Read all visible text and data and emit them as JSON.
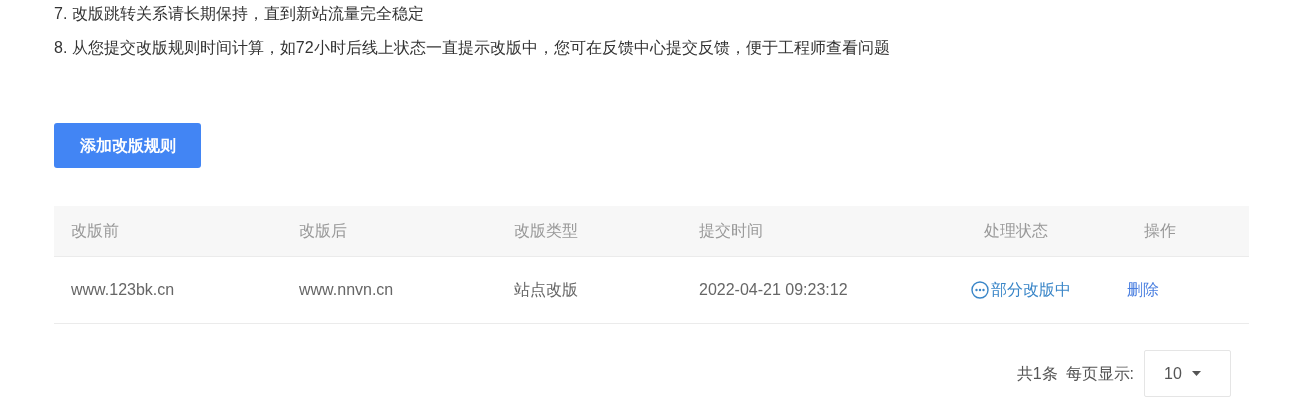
{
  "notes": [
    "7. 改版跳转关系请长期保持，直到新站流量完全稳定",
    "8. 从您提交改版规则时间计算，如72小时后线上状态一直提示改版中，您可在反馈中心提交反馈，便于工程师查看问题"
  ],
  "add_button": "添加改版规则",
  "table": {
    "columns": [
      "改版前",
      "改版后",
      "改版类型",
      "提交时间",
      "处理状态",
      "操作"
    ],
    "rows": [
      {
        "before": "www.123bk.cn",
        "after": "www.nnvn.cn",
        "type": "站点改版",
        "time": "2022-04-21 09:23:12",
        "status": {
          "kind": "processing",
          "label": "部分改版中"
        },
        "action": "删除"
      }
    ]
  },
  "pagination": {
    "total": "共1条",
    "per_page_label": "每页显示:",
    "per_page": "10"
  }
}
